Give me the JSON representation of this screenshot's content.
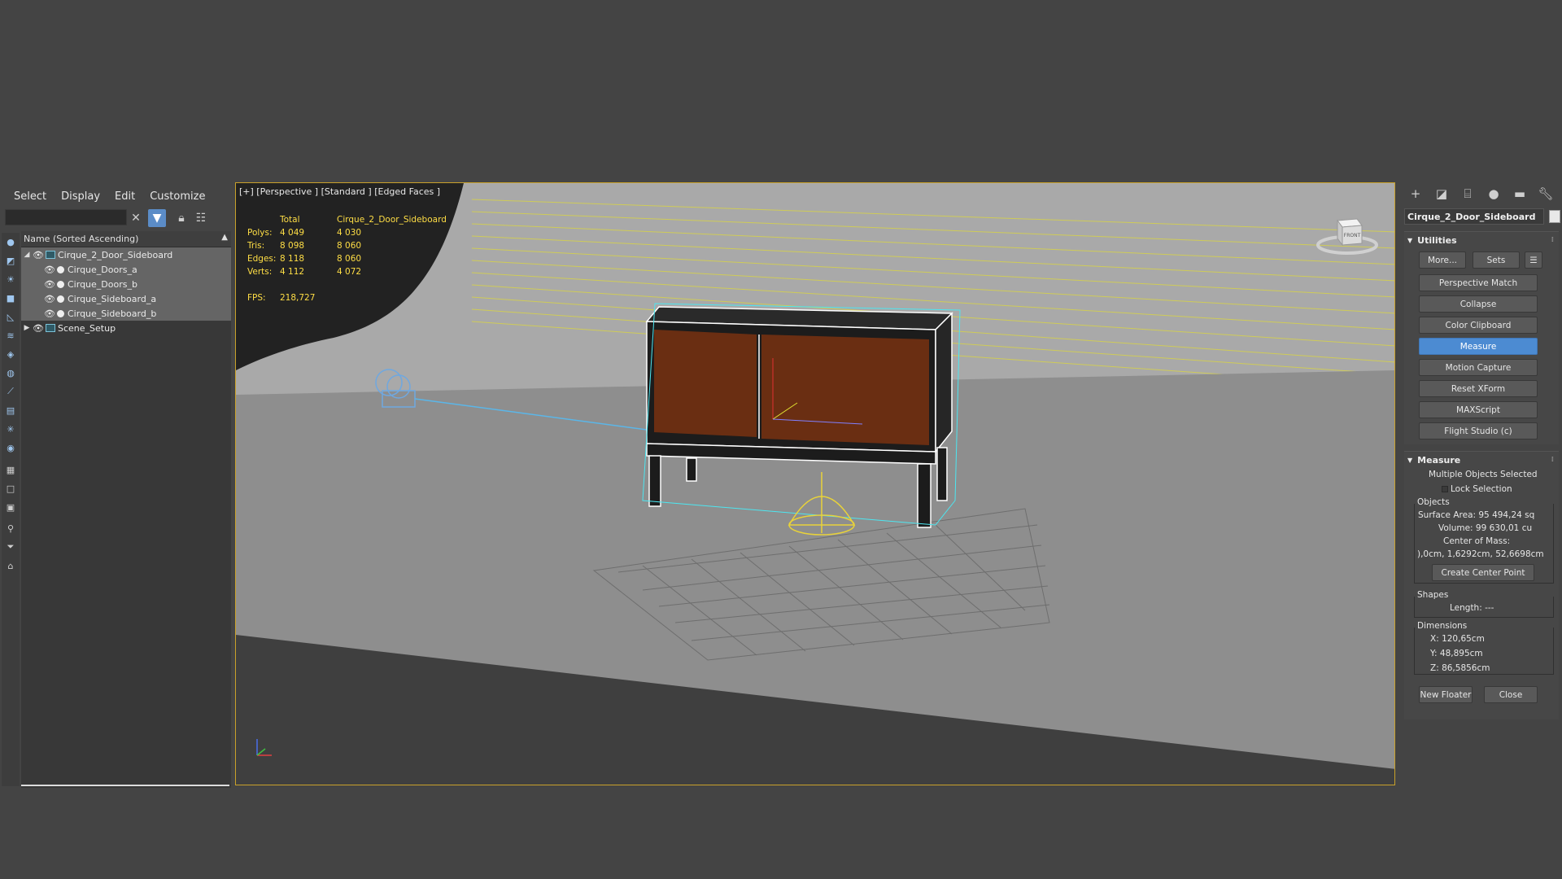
{
  "explorer": {
    "menu": [
      "Select",
      "Display",
      "Edit",
      "Customize"
    ],
    "column_header": "Name (Sorted Ascending)",
    "tree": [
      {
        "label": "Cirque_2_Door_Sideboard",
        "level": 0,
        "expanded": true,
        "selected": true
      },
      {
        "label": "Cirque_Doors_a",
        "level": 1,
        "selected": true
      },
      {
        "label": "Cirque_Doors_b",
        "level": 1,
        "selected": true
      },
      {
        "label": "Cirque_Sideboard_a",
        "level": 1,
        "selected": true
      },
      {
        "label": "Cirque_Sideboard_b",
        "level": 1,
        "selected": true
      },
      {
        "label": "Scene_Setup",
        "level": 0,
        "expanded": false,
        "selected": false
      }
    ]
  },
  "viewport": {
    "label": "[+] [Perspective ] [Standard ] [Edged Faces ]",
    "stats": {
      "col_total": "Total",
      "col_object": "Cirque_2_Door_Sideboard",
      "rows": [
        {
          "name": "Polys:",
          "total": "4 049",
          "object": "4 030"
        },
        {
          "name": "Tris:",
          "total": "8 098",
          "object": "8 060"
        },
        {
          "name": "Edges:",
          "total": "8 118",
          "object": "8 060"
        },
        {
          "name": "Verts:",
          "total": "4 112",
          "object": "4 072"
        }
      ],
      "fps_label": "FPS:",
      "fps_value": "218,727"
    },
    "viewcube_label": "FRONT"
  },
  "command_panel": {
    "object_name": "Cirque_2_Door_Sideboard",
    "utilities": {
      "title": "Utilities",
      "more": "More...",
      "sets": "Sets",
      "buttons": [
        "Perspective Match",
        "Collapse",
        "Color Clipboard",
        "Measure",
        "Motion Capture",
        "Reset XForm",
        "MAXScript",
        "Flight Studio (c)"
      ],
      "active": "Measure"
    },
    "measure": {
      "title": "Measure",
      "status": "Multiple Objects Selected",
      "lock_selection": "Lock Selection",
      "objects_title": "Objects",
      "surface_area": "Surface Area: 95 494,24 sq",
      "volume": "Volume: 99 630,01 cu",
      "center_of_mass": "Center of Mass:",
      "center_value": "),0cm, 1,6292cm, 52,6698cm",
      "create_center": "Create Center Point",
      "shapes_title": "Shapes",
      "length": "Length: ---",
      "dimensions_title": "Dimensions",
      "x": "X:   120,65cm",
      "y": "Y:   48,895cm",
      "z": "Z:   86,5856cm",
      "new_floater": "New Floater",
      "close": "Close"
    }
  }
}
